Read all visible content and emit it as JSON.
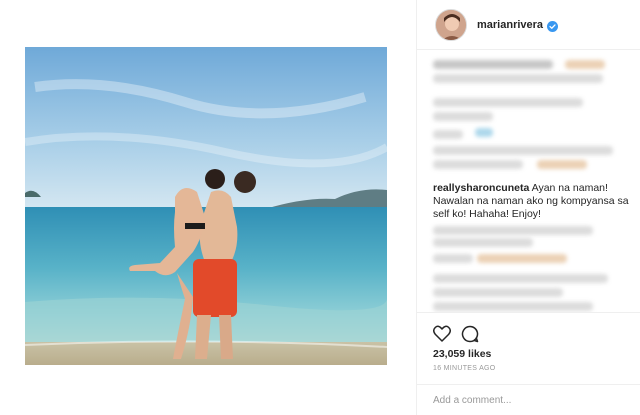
{
  "header": {
    "username": "marianrivera",
    "verified_icon": "verified-badge-icon",
    "verified_color": "#3897f0"
  },
  "comments": {
    "visible": {
      "author": "reallysharoncuneta",
      "text": "Ayan na naman! Nawalan na naman ako ng kompyansa sa self ko! Hahaha! Enjoy!"
    }
  },
  "actions": {
    "like_icon": "heart-icon",
    "comment_icon": "comment-bubble-icon"
  },
  "likes": "23,059 likes",
  "timestamp": "16 MINUTES AGO",
  "add_comment": {
    "placeholder": "Add a comment..."
  },
  "colors": {
    "border": "#efefef",
    "text": "#262626",
    "muted": "#999999",
    "sky_top": "#7fb6e0",
    "sea": "#5db2c7"
  }
}
